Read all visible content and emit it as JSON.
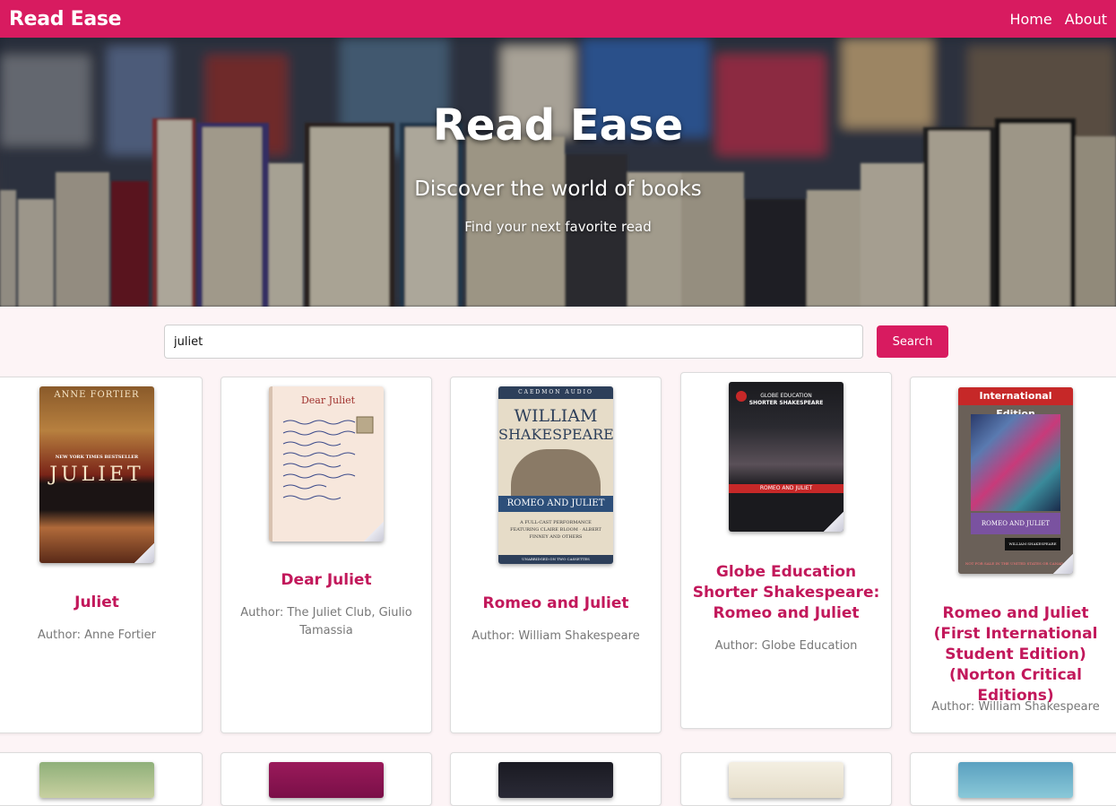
{
  "navbar": {
    "brand": "Read Ease",
    "links": [
      "Home",
      "About"
    ]
  },
  "hero": {
    "title": "Read Ease",
    "subtitle": "Discover the world of books",
    "tagline": "Find your next favorite read"
  },
  "search": {
    "value": "juliet",
    "button_label": "Search"
  },
  "books": [
    {
      "title": "Juliet",
      "author": "Author: Anne Fortier"
    },
    {
      "title": "Dear Juliet",
      "author": "Author: The Juliet Club, Giulio Tamassia"
    },
    {
      "title": "Romeo and Juliet",
      "author": "Author: William Shakespeare"
    },
    {
      "title": "Globe Education Shorter Shakespeare: Romeo and Juliet",
      "author": "Author: Globe Education"
    },
    {
      "title": "Romeo and Juliet (First International Student Edition) (Norton Critical Editions)",
      "author": "Author: William Shakespeare"
    }
  ],
  "covers": {
    "c1": {
      "top": "ANNE FORTIER",
      "band": "NEW YORK TIMES BESTSELLER",
      "main": "JULIET"
    },
    "c2": {
      "top": "Dear Juliet"
    },
    "c3": {
      "top": "CAEDMON AUDIO",
      "main1": "WILLIAM",
      "main2": "SHAKESPEARE",
      "band": "ROMEO AND JULIET",
      "sub": "A FULL-CAST PERFORMANCE FEATURING CLAIRE BLOOM · ALBERT FINNEY AND OTHERS",
      "foot": "UNABRIDGED ON TWO CASSETTES"
    },
    "c4": {
      "top1": "GLOBE EDUCATION",
      "top2": "SHORTER SHAKESPEARE",
      "band": "ROMEO AND JULIET"
    },
    "c5": {
      "top": "International Edition",
      "band": "ROMEO AND JULIET",
      "author": "WILLIAM SHAKESPEARE",
      "foot": "NOT FOR SALE IN THE UNITED STATES OR CANADA"
    }
  },
  "colors": {
    "accent": "#d81b60",
    "title": "#c2185b"
  }
}
